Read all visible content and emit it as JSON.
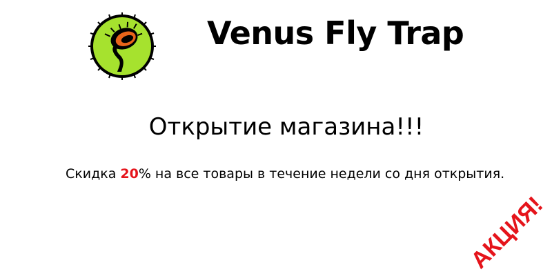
{
  "header": {
    "logo_icon": "venus-fly-trap-logo-icon",
    "title": "Venus Fly Trap"
  },
  "main": {
    "headline": "Открытие магазина!!!",
    "promo": {
      "before": "Скидка ",
      "discount": "20",
      "after": "% на все товары в течение недели со дня открытия."
    },
    "stamp": "АКЦИЯ!"
  },
  "colors": {
    "accent_red": "#e5141b",
    "logo_green": "#a6e22e",
    "logo_orange": "#e8641a"
  }
}
